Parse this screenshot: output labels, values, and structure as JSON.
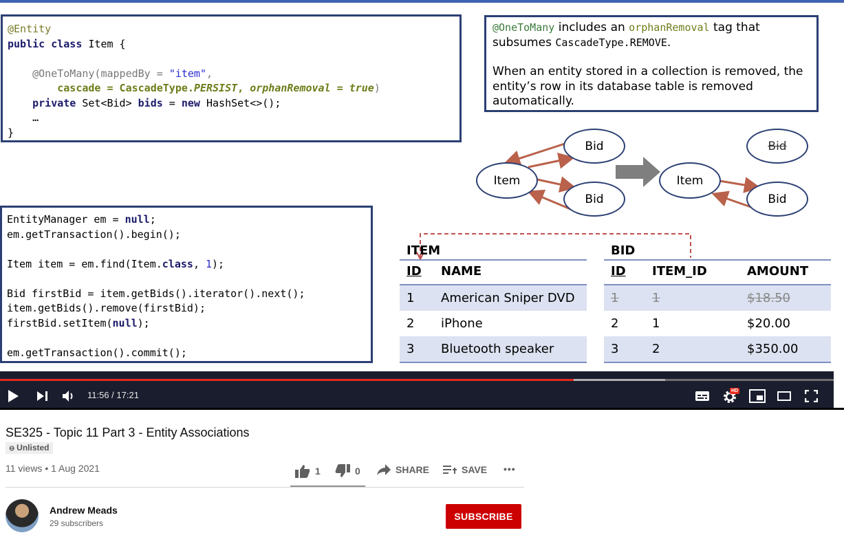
{
  "slide": {
    "code_top": {
      "line1": "@Entity",
      "line2_kw1": "public",
      "line2_kw2": "class",
      "line2_rest": " Item {",
      "line3_ann": "@OneToMany(mappedBy = ",
      "line3_str": "\"item\"",
      "line3_end": ",",
      "line4_a": "cascade = CascadeType.",
      "line4_b": "PERSIST",
      "line4_c": ", ",
      "line4_d": "orphanRemoval = true",
      "line4_e": ")",
      "line5_kw": "private",
      "line5_mid": " Set<Bid> ",
      "line5_bids": "bids",
      "line5_eq": " = ",
      "line5_new": "new",
      "line5_end": " HashSet<>();",
      "line6": "…",
      "line7": "}"
    },
    "note": {
      "p1_code1": "@OneToMany",
      "p1_text1": " includes an ",
      "p1_code2": "orphanRemoval",
      "p1_text2": " tag that subsumes ",
      "p1_code3": "CascadeType.REMOVE",
      "p1_text3": ".",
      "p2": "When an entity stored in a collection is removed, the entity’s row in its database table is removed automatically."
    },
    "diagram": {
      "item_label": "Item",
      "bid_label": "Bid",
      "item_label_after": "Item",
      "bid_removed_label": "Bid",
      "bid_remaining_label": "Bid"
    },
    "code_bottom": {
      "l1a": "EntityManager em = ",
      "l1b": "null",
      "l1c": ";",
      "l2": "em.getTransaction().begin();",
      "l3a": "Item item = em.find(Item.",
      "l3b": "class",
      "l3c": ", ",
      "l3d": "1",
      "l3e": ");",
      "l4": "Bid firstBid = item.getBids().iterator().next();",
      "l5": "item.getBids().remove(firstBid);",
      "l6a": "firstBid.setItem(",
      "l6b": "null",
      "l6c": ");",
      "l7": "em.getTransaction().commit();"
    },
    "item_table": {
      "title": "ITEM",
      "headers": [
        "ID",
        "NAME"
      ],
      "rows": [
        [
          "1",
          "American Sniper DVD"
        ],
        [
          "2",
          "iPhone"
        ],
        [
          "3",
          "Bluetooth speaker"
        ]
      ]
    },
    "bid_table": {
      "title": "BID",
      "headers": [
        "ID",
        "ITEM_ID",
        "AMOUNT"
      ],
      "rows": [
        [
          "1",
          "1",
          "$18.50"
        ],
        [
          "2",
          "1",
          "$20.00"
        ],
        [
          "3",
          "2",
          "$350.00"
        ]
      ]
    }
  },
  "player": {
    "time": "11:56 / 17:21",
    "progress_fraction": 0.688,
    "hd_badge": "HD"
  },
  "video": {
    "title": "SE325 - Topic 11 Part 3 - Entity Associations",
    "visibility": "Unlisted",
    "meta": "11 views • 1 Aug 2021",
    "likes": "1",
    "dislikes": "0",
    "share_label": "SHARE",
    "save_label": "SAVE",
    "more_label": "•••"
  },
  "channel": {
    "name": "Andrew Meads",
    "subscribers": "29 subscribers",
    "subscribe_label": "SUBSCRIBE"
  },
  "colors": {
    "accent_red": "#cc0000",
    "progress_red": "#e52a1d",
    "slide_border": "#2b3f73",
    "table_shade": "#dce2f1",
    "arrow_color": "#b9614a"
  }
}
